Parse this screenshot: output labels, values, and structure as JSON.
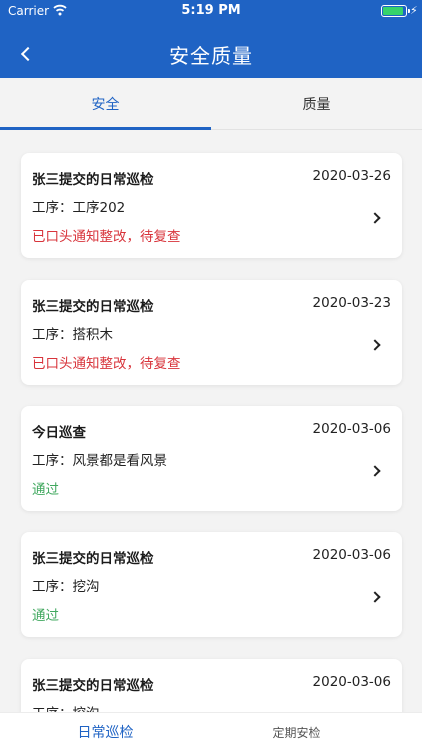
{
  "status_bar": {
    "carrier": "Carrier",
    "time": "5:19 PM"
  },
  "header": {
    "title": "安全质量"
  },
  "tabs": [
    {
      "label": "安全",
      "active": true
    },
    {
      "label": "质量",
      "active": false
    }
  ],
  "records": [
    {
      "title": "张三提交的日常巡检",
      "date": "2020-03-26",
      "process": "工序：工序202",
      "status": "已口头通知整改，待复查",
      "status_color": "#d8343b"
    },
    {
      "title": "张三提交的日常巡检",
      "date": "2020-03-23",
      "process": "工序：搭积木",
      "status": "已口头通知整改，待复查",
      "status_color": "#d8343b"
    },
    {
      "title": "今日巡查",
      "date": "2020-03-06",
      "process": "工序：风景都是看风景",
      "status": "通过",
      "status_color": "#41a85f"
    },
    {
      "title": "张三提交的日常巡检",
      "date": "2020-03-06",
      "process": "工序：挖沟",
      "status": "通过",
      "status_color": "#41a85f"
    },
    {
      "title": "张三提交的日常巡检",
      "date": "2020-03-06",
      "process": "工序：挖沟",
      "status": "",
      "status_color": "#41a85f"
    }
  ],
  "bottom_tabs": [
    {
      "label": "日常巡检",
      "active": true
    },
    {
      "label": "定期安检",
      "active": false
    }
  ],
  "colors": {
    "primary": "#1f63c4",
    "danger": "#d8343b",
    "success": "#41a85f"
  }
}
